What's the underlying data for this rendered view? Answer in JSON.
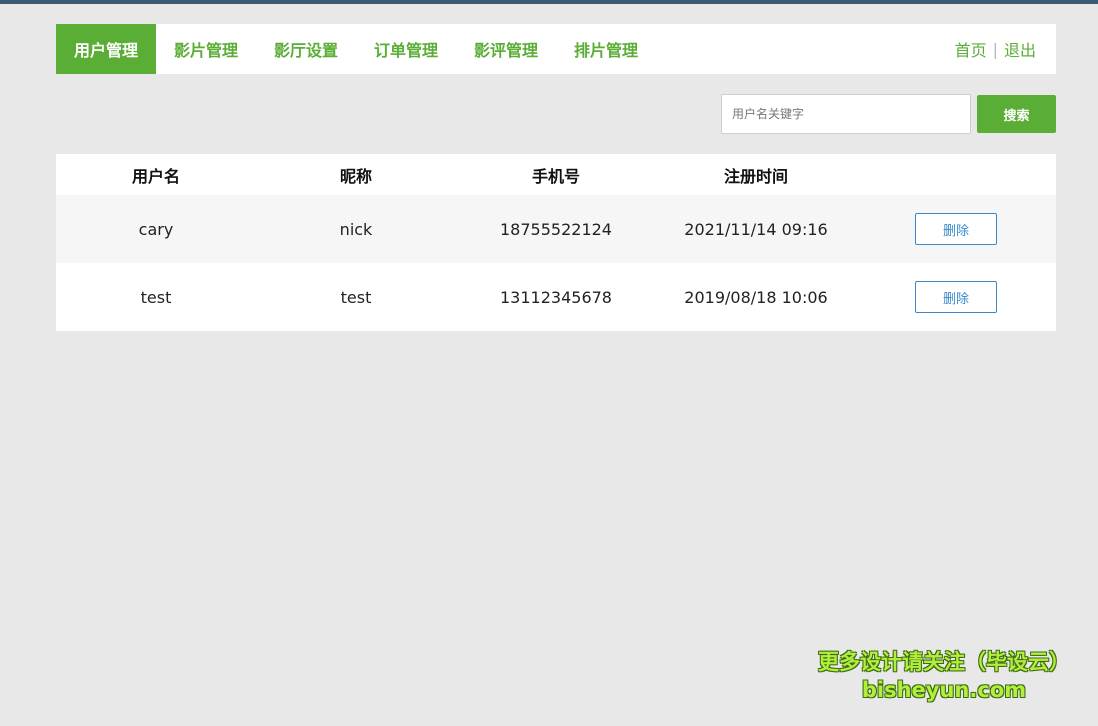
{
  "nav": {
    "items": [
      {
        "label": "用户管理",
        "active": true
      },
      {
        "label": "影片管理",
        "active": false
      },
      {
        "label": "影厅设置",
        "active": false
      },
      {
        "label": "订单管理",
        "active": false
      },
      {
        "label": "影评管理",
        "active": false
      },
      {
        "label": "排片管理",
        "active": false
      }
    ],
    "home_label": "首页",
    "separator": "|",
    "logout_label": "退出"
  },
  "search": {
    "placeholder": "用户名关键字",
    "value": "",
    "button_label": "搜索"
  },
  "table": {
    "columns": [
      "用户名",
      "昵称",
      "手机号",
      "注册时间",
      ""
    ],
    "rows": [
      {
        "username": "cary",
        "nickname": "nick",
        "phone": "18755522124",
        "registered": "2021/11/14 09:16",
        "action": "删除"
      },
      {
        "username": "test",
        "nickname": "test",
        "phone": "13112345678",
        "registered": "2019/08/18 10:06",
        "action": "删除"
      }
    ]
  },
  "watermark": {
    "line1": "更多设计请关注（毕设云）",
    "line2": "bisheyun.com"
  },
  "colors": {
    "accent": "#5aad35",
    "link_blue": "#3a88c8",
    "topbar": "#3d5a73",
    "background": "#e8e8e8"
  }
}
